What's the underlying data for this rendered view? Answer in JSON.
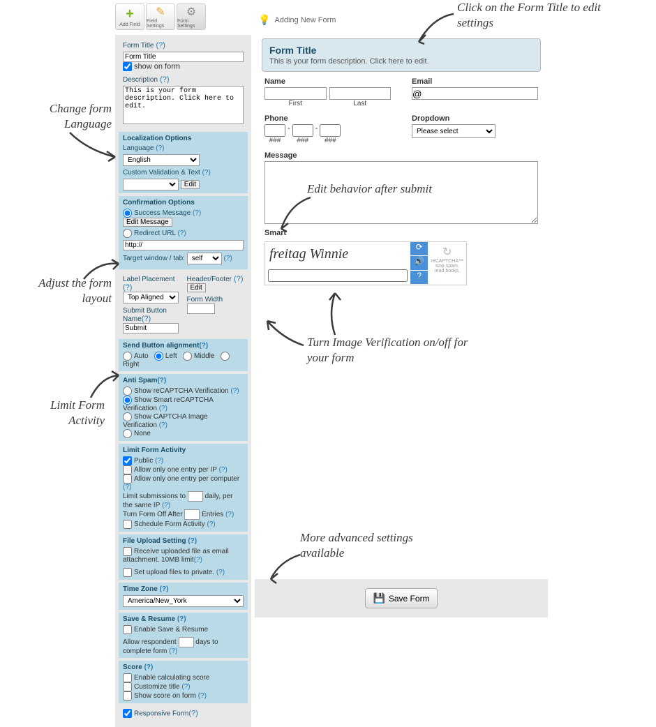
{
  "toolbar": {
    "add": "Add Field",
    "field": "Field Settings",
    "form": "Form Settings",
    "hint": "Adding New Form"
  },
  "title": {
    "label": "Form Title",
    "help": "(?)",
    "value": "Form Title",
    "show": "show on form",
    "desc_label": "Description",
    "desc_help": "(?)",
    "desc_value": "This is your form description. Click here to edit."
  },
  "local": {
    "title": "Localization Options",
    "lang_label": "Language",
    "lang_help": "(?)",
    "lang_value": "English",
    "custom_label": "Custom Validation & Text",
    "custom_help": "(?)",
    "edit": "Edit"
  },
  "confirm": {
    "title": "Confirmation Options",
    "success": "Success Message",
    "success_help": "(?)",
    "edit_msg": "Edit Message",
    "redirect": "Redirect URL",
    "redirect_help": "(?)",
    "url": "http://",
    "target": "Target window / tab:",
    "target_val": "self",
    "target_help": "(?)"
  },
  "layout": {
    "label_place": "Label Placement",
    "lp_help": "(?)",
    "lp_val": "Top Aligned",
    "header": "Header/Footer",
    "h_help": "(?)",
    "h_edit": "Edit",
    "submit_name": "Submit Button Name",
    "sn_help": "(?)",
    "sn_val": "Submit",
    "width": "Form Width"
  },
  "send": {
    "title": "Send Button alignment",
    "help": "(?)",
    "auto": "Auto",
    "left": "Left",
    "middle": "Middle",
    "right": "Right"
  },
  "anti": {
    "title": "Anti Spam",
    "help": "(?)",
    "o1": "Show reCAPTCHA Verification",
    "o2": "Show Smart reCAPTCHA Verification",
    "o3": "Show CAPTCHA Image Verification",
    "o4": "None"
  },
  "limit": {
    "title": "Limit Form Activity",
    "public": "Public",
    "help": "(?)",
    "ip": "Allow only one entry per IP",
    "comp": "Allow only one entry per computer",
    "sub1": "Limit submissions to",
    "sub2": "daily, per the same IP",
    "off1": "Turn Form Off After",
    "off2": "Entries",
    "sched": "Schedule Form Activity"
  },
  "file": {
    "title": "File Upload Setting",
    "help": "(?)",
    "attach": "Receive uploaded file as email attachment. 10MB limit",
    "priv": "Set upload files to private."
  },
  "tz": {
    "title": "Time Zone",
    "help": "(?)",
    "val": "America/New_York"
  },
  "save": {
    "title": "Save & Resume",
    "help": "(?)",
    "enable": "Enable Save & Resume",
    "allow1": "Allow respondent",
    "allow2": "days to complete form"
  },
  "score": {
    "title": "Score",
    "help": "(?)",
    "calc": "Enable calculating score",
    "cust": "Customize title",
    "show": "Show score on form"
  },
  "resp": {
    "label": "Responsive Form",
    "help": "(?)"
  },
  "preview": {
    "title": "Form Title",
    "desc": "This is your form description. Click here to edit.",
    "name": "Name",
    "first": "First",
    "last": "Last",
    "email": "Email",
    "email_val": "@",
    "phone": "Phone",
    "ph": "###",
    "dropdown": "Dropdown",
    "dd_val": "Please select",
    "message": "Message",
    "smart": "Smart",
    "capt_text": "freitag  Winnie",
    "capt_note1": "stop spam.",
    "capt_note2": "read books."
  },
  "save_btn": "Save Form",
  "callouts": {
    "c1": "Click on the Form Title to edit settings",
    "c2": "Change form Language",
    "c3": "Edit behavior after submit",
    "c4": "Adjust the form layout",
    "c5": "Turn Image Verification on/off for your form",
    "c6": "Limit Form Activity",
    "c7": "More advanced settings available"
  }
}
